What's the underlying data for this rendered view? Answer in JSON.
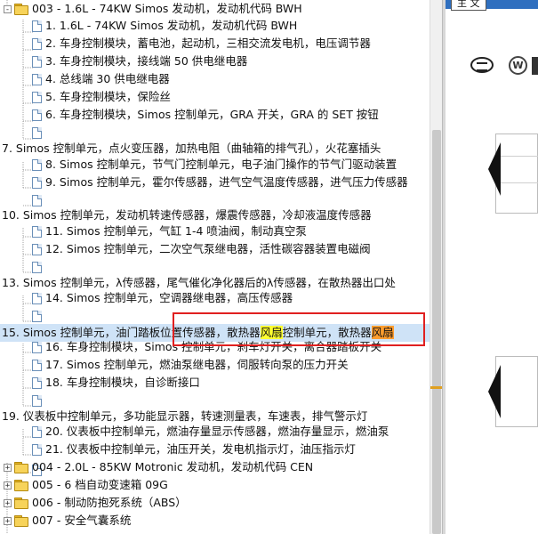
{
  "tree": {
    "rows": [
      {
        "text": "003 - 1.6L - 74KW Simos 发动机，发动机代码 BWH",
        "icon": "folder-icon",
        "expander": "-"
      },
      {
        "text": "1. 1.6L - 74KW Simos 发动机，发动机代码 BWH",
        "icon": "document-icon"
      },
      {
        "text": "2. 车身控制模块，蓄电池，起动机，三相交流发电机，电压调节器",
        "icon": "document-icon"
      },
      {
        "text": "3. 车身控制模块，接线端 50 供电继电器",
        "icon": "document-icon"
      },
      {
        "text": "4. 总线端 30 供电继电器",
        "icon": "document-icon"
      },
      {
        "text": "5. 车身控制模块，保险丝",
        "icon": "document-icon"
      },
      {
        "text": "6. 车身控制模块，Simos 控制单元，GRA 开关，GRA 的 SET 按钮",
        "icon": "document-icon"
      },
      {
        "text": "",
        "icon": "document-icon"
      },
      {
        "text": "7. Simos 控制单元，点火变压器，加热电阻（曲轴箱的排气孔），火花塞插头",
        "icon": ""
      },
      {
        "text": "8. Simos 控制单元，节气门控制单元，电子油门操作的节气门驱动装置",
        "icon": "document-icon"
      },
      {
        "text": "9. Simos 控制单元，霍尔传感器，进气空气温度传感器，进气压力传感器",
        "icon": "document-icon"
      },
      {
        "text": "",
        "icon": "document-icon"
      },
      {
        "text": "10. Simos 控制单元，发动机转速传感器，爆震传感器，冷却液温度传感器",
        "icon": ""
      },
      {
        "text": "11. Simos 控制单元，气缸 1-4 喷油阀，制动真空泵",
        "icon": "document-icon"
      },
      {
        "text": "12. Simos 控制单元，二次空气泵继电器，活性碳容器装置电磁阀",
        "icon": "document-icon"
      },
      {
        "text": "",
        "icon": "document-icon"
      },
      {
        "text": "13. Simos 控制单元，λ传感器，尾气催化净化器后的λ传感器，在散热器出口处",
        "icon": ""
      },
      {
        "text": "14. Simos 控制单元，空调器继电器，高压传感器",
        "icon": "document-icon"
      },
      {
        "text": "",
        "icon": "document-icon"
      },
      {
        "text_parts": [
          "15. Simos 控制单元，油门踏板位置传感器，散热器",
          "风扇",
          "控制单元，散热器",
          "风扇"
        ],
        "icon": "",
        "selected": true
      },
      {
        "text": "16. 车身控制模块，Simos 控制单元，刹车灯开关，离合器踏板开关",
        "icon": "document-icon"
      },
      {
        "text": "17. Simos 控制单元，燃油泵继电器，伺服转向泵的压力开关",
        "icon": "document-icon"
      },
      {
        "text": "18. 车身控制模块，自诊断接口",
        "icon": "document-icon"
      },
      {
        "text": "",
        "icon": "document-icon"
      },
      {
        "text": "19. 仪表板中控制单元，多功能显示器，转速测量表，车速表，排气警示灯",
        "icon": ""
      },
      {
        "text": "20. 仪表板中控制单元，燃油存量显示传感器，燃油存量显示，燃油泵",
        "icon": "document-icon"
      },
      {
        "text": "21. 仪表板中控制单元，油压开关，发电机指示灯，油压指示灯",
        "icon": "document-icon"
      },
      {
        "text": "",
        "icon": "document-icon"
      },
      {
        "text": "004 - 2.0L - 85KW Motronic 发动机，发动机代码 CEN",
        "icon": "folder-icon",
        "expander": "+"
      },
      {
        "text": "005 - 6 档自动变速箱 09G",
        "icon": "folder-icon",
        "expander": "+"
      },
      {
        "text": "006 - 制动防抱死系统（ABS）",
        "icon": "folder-icon",
        "expander": "+"
      },
      {
        "text": "007 - 安全气囊系统",
        "icon": "folder-icon",
        "expander": "+"
      }
    ]
  },
  "viewer": {
    "tab_label": "主 文",
    "logo_vw": "W"
  },
  "colors": {
    "highlight_yellow": "#ffff30",
    "highlight_orange": "#ff9d2e",
    "selection": "#cfe3f7",
    "annotation_box": "#e02020"
  }
}
